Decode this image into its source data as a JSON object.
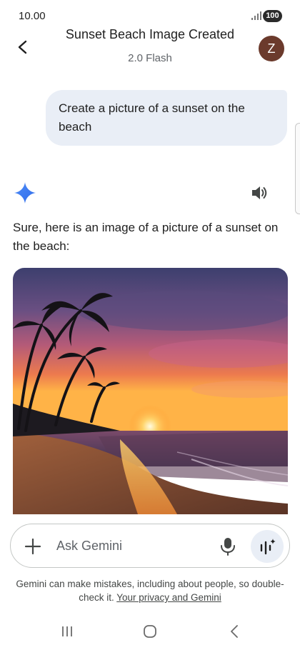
{
  "status_bar": {
    "time": "10.00",
    "battery": "100"
  },
  "header": {
    "title": "Sunset Beach Image Created",
    "subtitle": "2.0 Flash",
    "avatar_initial": "Z"
  },
  "conversation": {
    "user_prompt": "Create a picture of a sunset on the beach",
    "response_text": "Sure, here is an image of a picture of a sunset on the beach:"
  },
  "input": {
    "placeholder": "Ask Gemini"
  },
  "disclaimer": {
    "text": "Gemini can make mistakes, including about people, so double-check it. ",
    "link": "Your privacy and Gemini"
  },
  "icons": {
    "back": "back-arrow-icon",
    "spark": "gemini-spark-icon",
    "speaker": "speaker-icon",
    "plus": "plus-icon",
    "mic": "microphone-icon",
    "live": "gemini-live-icon"
  },
  "colors": {
    "accent": "#4285f4",
    "bubble": "#e9eef6",
    "avatar": "#6b3a2c"
  }
}
